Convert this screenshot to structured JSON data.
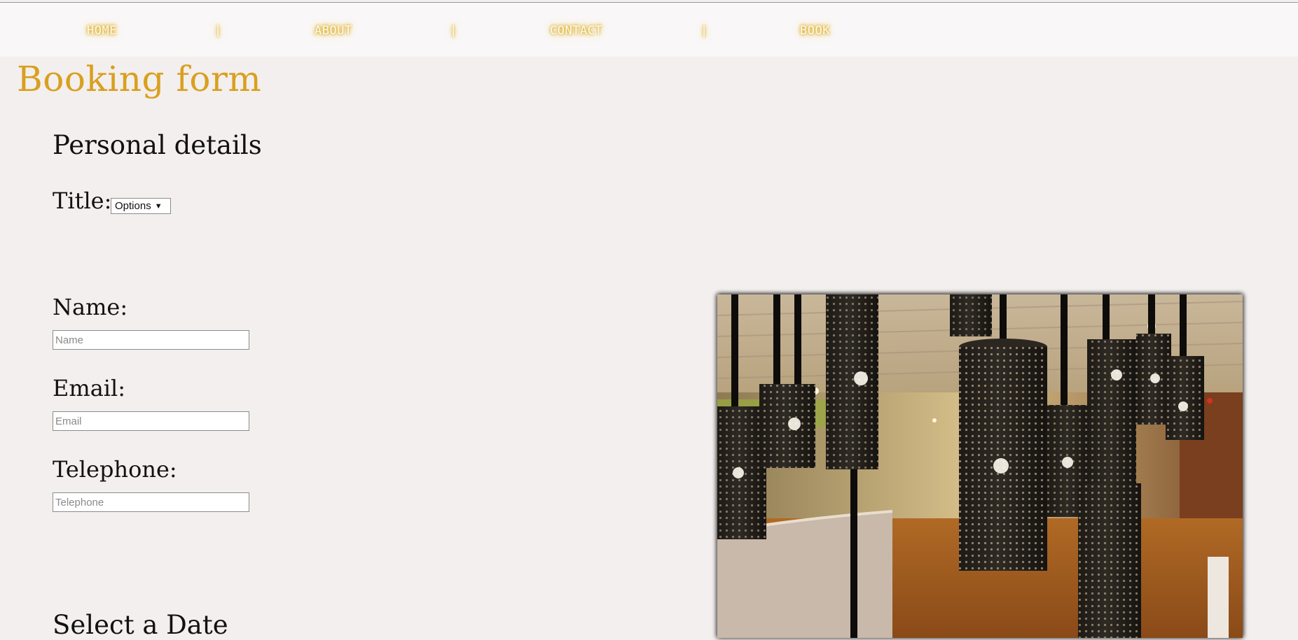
{
  "nav": {
    "items": [
      "HOME",
      "ABOUT",
      "CONTACT",
      "BOOK"
    ],
    "separator": "|",
    "glow_color": "#d9a020"
  },
  "page": {
    "title": "Booking form",
    "title_color": "#d9a020",
    "background": "#f3efee"
  },
  "personal": {
    "heading": "Personal details",
    "title_label": "Title:",
    "title_select_value": "Options",
    "name_label": "Name:",
    "name_placeholder": "Name",
    "email_label": "Email:",
    "email_placeholder": "Email",
    "telephone_label": "Telephone:",
    "telephone_placeholder": "Telephone"
  },
  "date_section": {
    "heading": "Select a Date"
  },
  "image": {
    "subject": "hotel lobby with hanging perforated cylinder lamps"
  }
}
